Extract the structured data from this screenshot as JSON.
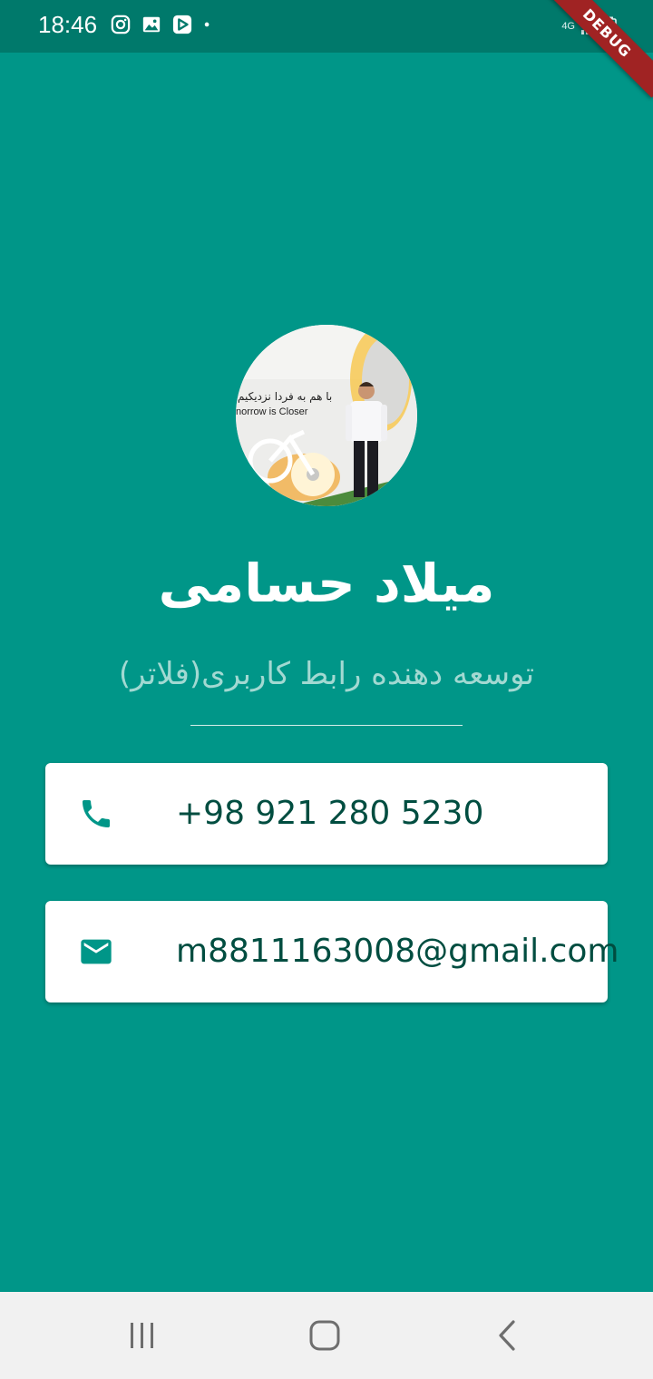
{
  "status_bar": {
    "time": "18:46",
    "network": "4G",
    "icons": [
      "instagram-icon",
      "gallery-icon",
      "play-store-icon",
      "notification-dot-icon",
      "signal-icon",
      "battery-icon"
    ]
  },
  "debug_banner": "DEBUG",
  "profile": {
    "name": "میلاد حسامی",
    "job_title": "توسعه دهنده رابط کاربری(فلاتر)",
    "photo_caption_fa": "با هم به فردا نزدیکیم",
    "photo_caption_en": "norrow is Closer"
  },
  "contacts": {
    "phone": "+98 921 280 5230",
    "email": "m8811163008@gmail.com"
  },
  "colors": {
    "background": "#009688",
    "status_bar": "#00796b",
    "card_text": "#004d40",
    "icon": "#009688",
    "subtitle": "#a2d9d2"
  }
}
